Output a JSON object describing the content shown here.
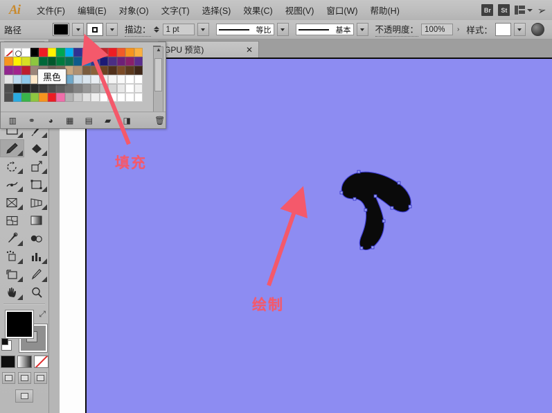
{
  "app": {
    "logo": "Ai",
    "brand_color": "#c98a2e"
  },
  "menubar": {
    "items": [
      {
        "label": "文件(F)"
      },
      {
        "label": "编辑(E)"
      },
      {
        "label": "对象(O)"
      },
      {
        "label": "文字(T)"
      },
      {
        "label": "选择(S)"
      },
      {
        "label": "效果(C)"
      },
      {
        "label": "视图(V)"
      },
      {
        "label": "窗口(W)"
      },
      {
        "label": "帮助(H)"
      }
    ],
    "bridge_label": "Br",
    "stock_label": "St",
    "workspace_icon": "workspace-grid-icon",
    "rocket_icon": "rocket-icon"
  },
  "optionsbar": {
    "selection_label": "路径",
    "fill_swatch_color": "#000000",
    "stroke_swatch_color": "#ffffff",
    "stroke_label": "描边：",
    "stroke_weight": "1 pt",
    "profile_label": "等比",
    "brush_label": "基本",
    "opacity_label": "不透明度：",
    "opacity_value": "100%",
    "style_label": "样式：",
    "style_swatch_color": "#ffffff"
  },
  "tabstrip": {
    "tab_title": "GPU 预览)",
    "close_label": "✕"
  },
  "swatches_panel": {
    "title_icon": "panel-menu-icon",
    "tooltip": "黑色",
    "selected_swatch": "#000000",
    "rows": [
      [
        "none",
        "reg",
        "#ffffff",
        "#000000",
        "#ed1c24",
        "#fff200",
        "#00a651",
        "#00aeef",
        "#2e3192",
        "#ec008c",
        "#9e1f63",
        "#c1272d",
        "#ed1c24",
        "#f15a29",
        "#f7941e",
        "#fbb040"
      ],
      [
        "#f7941e",
        "#fff200",
        "#d7df23",
        "#8dc63f",
        "#006838",
        "#00572b",
        "#007a3d",
        "#0b6e4f",
        "#0e5b8a",
        "#1b75bb",
        "#2b3990",
        "#1c1a75",
        "#4b2e83",
        "#6d2077",
        "#8a1f6b",
        "#5b2d8e"
      ],
      [
        "#92278f",
        "#a3238e",
        "#be1e2d",
        "#9b8579",
        "#8c7b6e",
        "#6d5f54",
        "#7c6a58",
        "#c8a882",
        "#b09172",
        "#7a5c3e",
        "#8b6239",
        "#6b4322",
        "#51301a",
        "#7b4b26",
        "#5c3a1e",
        "#3f2718"
      ],
      [
        "#e6e6e6",
        "#bcd9ef",
        "#8fc9ea",
        "#ffe8c9",
        "#f2b47e",
        "#cfe8d6",
        "#9fd4c8",
        "#6fa8c9",
        "#c9dcea",
        "#dbe6ef",
        "#e9eef3",
        "#f0f0f0",
        "#f5f5f5",
        "#fafafa",
        "#ffffff",
        "#ffffff"
      ],
      [
        "#4f4f4f",
        "#111111",
        "#1d1d1d",
        "#2b2b2b",
        "#3a3a3a",
        "#4c4c4c",
        "#5e5e5e",
        "#707070",
        "#848484",
        "#989898",
        "#acacac",
        "#c0c0c0",
        "#d4d4d4",
        "#e8e8e8",
        "#ffffff",
        "#f2f2f2"
      ],
      [
        "#4f4f4f",
        "#29abe2",
        "#39b54a",
        "#8dc63f",
        "#f7941e",
        "#ed1c24",
        "#f06eaa",
        "#b3b3b3",
        "#cccccc",
        "#e0e0e0",
        "#eeeeee",
        "#ffffff",
        "#ffffff",
        "#ffffff",
        "#ffffff",
        "#ffffff"
      ]
    ],
    "footer_icons": [
      {
        "name": "swatch-libraries-icon",
        "glyph": "▥"
      },
      {
        "name": "color-group-link-icon",
        "glyph": "⚭"
      },
      {
        "name": "color-guide-icon",
        "glyph": "◕"
      },
      {
        "name": "show-swatch-kinds-icon",
        "glyph": "▦"
      },
      {
        "name": "swatch-options-icon",
        "glyph": "▤"
      },
      {
        "name": "new-color-group-icon",
        "glyph": "▰"
      },
      {
        "name": "new-swatch-icon",
        "glyph": "◨"
      },
      {
        "name": "delete-swatch-icon",
        "glyph": "🗑"
      }
    ]
  },
  "tools": {
    "rows": [
      [
        {
          "name": "selection-tool",
          "selected": false
        },
        {
          "name": "direct-selection-tool",
          "selected": false
        }
      ],
      [
        {
          "name": "magic-wand-tool",
          "selected": false
        },
        {
          "name": "lasso-tool",
          "selected": false
        }
      ],
      [
        {
          "name": "pen-tool",
          "selected": false
        },
        {
          "name": "curvature-tool",
          "selected": false
        }
      ],
      [
        {
          "name": "type-tool",
          "selected": false
        },
        {
          "name": "line-segment-tool",
          "selected": false
        }
      ],
      [
        {
          "name": "rectangle-tool",
          "selected": false
        },
        {
          "name": "paintbrush-tool",
          "selected": false
        }
      ],
      [
        {
          "name": "pencil-tool",
          "selected": true
        },
        {
          "name": "shaper-eraser-tool",
          "selected": false
        }
      ],
      [
        {
          "name": "rotate-tool",
          "selected": false
        },
        {
          "name": "scale-tool",
          "selected": false
        }
      ],
      [
        {
          "name": "width-tool",
          "selected": false
        },
        {
          "name": "free-transform-tool",
          "selected": false
        }
      ],
      [
        {
          "name": "shape-builder-tool",
          "selected": false
        },
        {
          "name": "perspective-grid-tool",
          "selected": false
        }
      ],
      [
        {
          "name": "mesh-tool",
          "selected": false
        },
        {
          "name": "gradient-tool",
          "selected": false
        }
      ],
      [
        {
          "name": "eyedropper-tool",
          "selected": false
        },
        {
          "name": "blend-tool",
          "selected": false
        }
      ],
      [
        {
          "name": "symbol-sprayer-tool",
          "selected": false
        },
        {
          "name": "column-graph-tool",
          "selected": false
        }
      ],
      [
        {
          "name": "artboard-tool",
          "selected": false
        },
        {
          "name": "slice-tool",
          "selected": false
        }
      ],
      [
        {
          "name": "hand-tool",
          "selected": false
        },
        {
          "name": "zoom-tool",
          "selected": false
        }
      ]
    ],
    "fill_color": "#000000",
    "stroke_color": "#8f8f8f",
    "swap_icon": "swap-fill-stroke-icon",
    "default_icon": "default-fill-stroke-icon",
    "mode_color_icon": "color-mode-icon",
    "mode_gradient_icon": "gradient-mode-icon",
    "mode_none_icon": "none-mode-icon",
    "drawing_modes": [
      "draw-normal-icon",
      "draw-behind-icon",
      "draw-inside-icon"
    ],
    "screen_mode_icon": "change-screen-mode-icon"
  },
  "canvas": {
    "artboard_color": "#8d8cf2",
    "scratch_color": "#fdfdfd",
    "shape_fill": "#0a0a0a",
    "path_stroke": "#3a3ad0"
  },
  "annotations": [
    {
      "name": "annotation-fill",
      "text": "填充",
      "color": "#f4596b"
    },
    {
      "name": "annotation-draw",
      "text": "绘制",
      "color": "#f4596b"
    }
  ]
}
